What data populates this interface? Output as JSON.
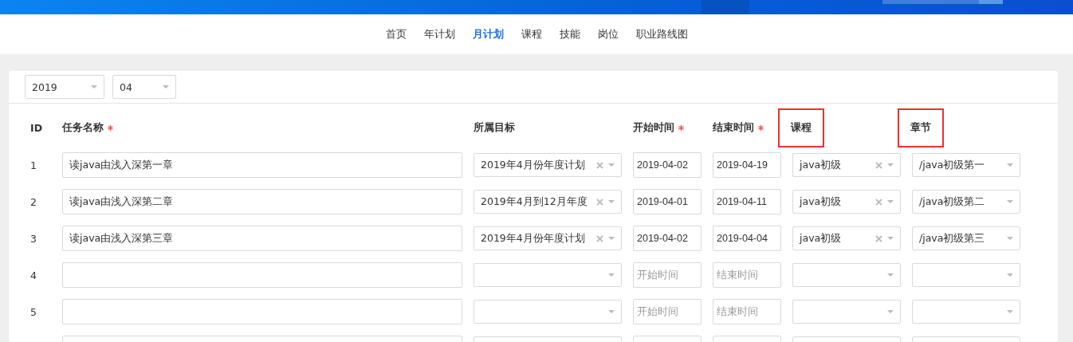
{
  "nav": {
    "items": [
      {
        "label": "首页",
        "selected": false
      },
      {
        "label": "年计划",
        "selected": false
      },
      {
        "label": "月计划",
        "selected": true
      },
      {
        "label": "课程",
        "selected": false
      },
      {
        "label": "技能",
        "selected": false
      },
      {
        "label": "岗位",
        "selected": false
      },
      {
        "label": "职业路线图",
        "selected": false
      }
    ]
  },
  "filters": {
    "year": "2019",
    "month": "04"
  },
  "table": {
    "columns": [
      {
        "label": "ID",
        "required": false,
        "highlighted": false
      },
      {
        "label": "任务名称",
        "required": true,
        "highlighted": false
      },
      {
        "label": "所属目标",
        "required": false,
        "highlighted": false
      },
      {
        "label": "开始时间",
        "required": true,
        "highlighted": false
      },
      {
        "label": "结束时间",
        "required": true,
        "highlighted": false
      },
      {
        "label": "课程",
        "required": false,
        "highlighted": true
      },
      {
        "label": "章节",
        "required": false,
        "highlighted": true
      }
    ],
    "rows": [
      {
        "id": "1",
        "name": {
          "value": "读java由浅入深第一章"
        },
        "goal": {
          "value": "2019年4月份年度计划"
        },
        "start": {
          "value": "2019-04-02"
        },
        "end": {
          "value": "2019-04-19"
        },
        "course": {
          "value": "java初级"
        },
        "chapter": {
          "value": "/java初级第一"
        }
      },
      {
        "id": "2",
        "name": {
          "value": "读java由浅入深第二章"
        },
        "goal": {
          "value": "2019年4月到12月年度"
        },
        "start": {
          "value": "2019-04-01"
        },
        "end": {
          "value": "2019-04-11"
        },
        "course": {
          "value": "java初级"
        },
        "chapter": {
          "value": "/java初级第二"
        }
      },
      {
        "id": "3",
        "name": {
          "value": "读java由浅入深第三章"
        },
        "goal": {
          "value": "2019年4月份年度计划"
        },
        "start": {
          "value": "2019-04-02"
        },
        "end": {
          "value": "2019-04-04"
        },
        "course": {
          "value": "java初级"
        },
        "chapter": {
          "value": "/java初级第三"
        }
      },
      {
        "id": "4",
        "name": {},
        "goal": {},
        "start": {
          "placeholder": "开始时间"
        },
        "end": {
          "placeholder": "结束时间"
        },
        "course": {},
        "chapter": {}
      },
      {
        "id": "5",
        "name": {},
        "goal": {},
        "start": {
          "placeholder": "开始时间"
        },
        "end": {
          "placeholder": "结束时间"
        },
        "course": {},
        "chapter": {}
      },
      {
        "name": {},
        "goal": {},
        "start": {},
        "end": {},
        "course": {},
        "chapter": {}
      }
    ]
  }
}
